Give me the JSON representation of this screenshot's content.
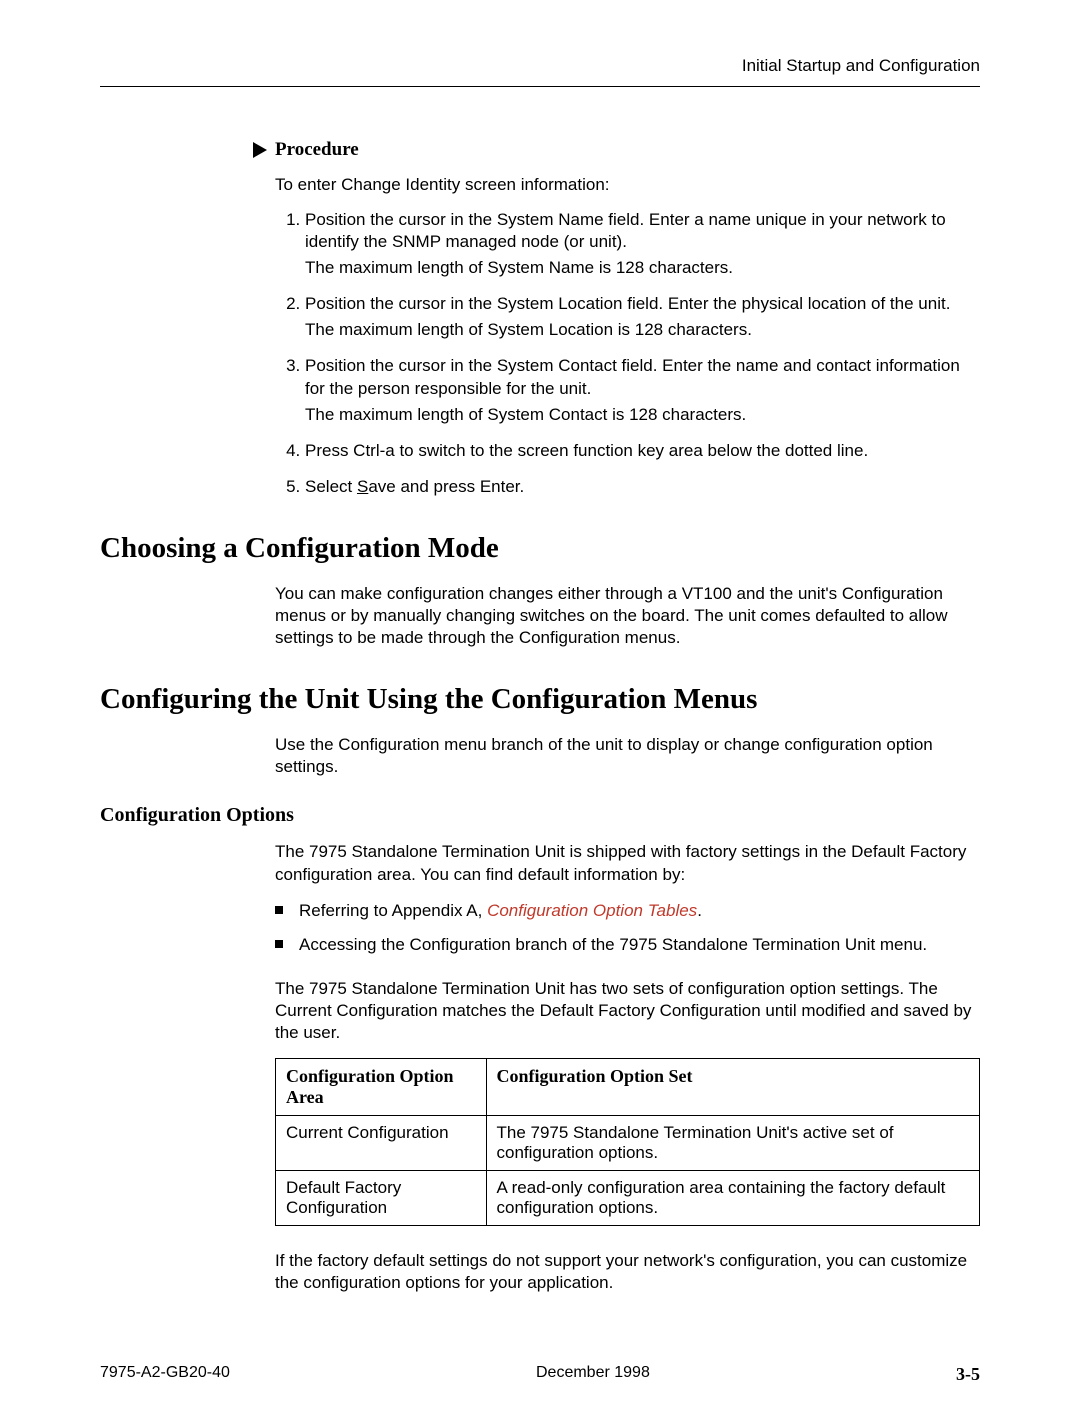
{
  "header": {
    "running_head": "Initial Startup and Configuration"
  },
  "procedure": {
    "label": "Procedure",
    "intro": "To enter Change Identity screen information:",
    "steps": [
      {
        "main": "Position the cursor in the System Name field. Enter a name unique in your network to identify the SNMP managed node (or unit).",
        "sub": "The maximum length of System Name is 128 characters."
      },
      {
        "main": "Position the cursor in the System Location field. Enter the physical location of the unit.",
        "sub": "The maximum length of System Location is 128 characters."
      },
      {
        "main": "Position the cursor in the System Contact field. Enter the name and contact information for the person responsible for the unit.",
        "sub": "The maximum length of System Contact is 128 characters."
      },
      {
        "main": "Press Ctrl-a to switch to the screen function key area below the dotted line.",
        "sub": ""
      },
      {
        "main_pre": "Select ",
        "main_u": "S",
        "main_post": "ave and press Enter.",
        "sub": ""
      }
    ]
  },
  "section1": {
    "title": "Choosing a Configuration Mode",
    "body": "You can make configuration changes either through a VT100 and the unit's Configuration menus or by manually changing switches on the board. The unit comes defaulted to allow settings to be made through the Configuration menus."
  },
  "section2": {
    "title": "Configuring the Unit Using the Configuration Menus",
    "body": "Use the Configuration menu branch of the unit to display or change configuration option settings."
  },
  "subsection": {
    "title": "Configuration Options",
    "p1": "The 7975 Standalone Termination Unit is shipped with factory settings in the Default Factory configuration area. You can find default information by:",
    "bullets": [
      {
        "pre": "Referring to Appendix A, ",
        "link": "Configuration Option Tables",
        "post": "."
      },
      {
        "pre": "Accessing the Configuration branch of the 7975 Standalone Termination Unit menu.",
        "link": "",
        "post": ""
      }
    ],
    "p2": "The 7975 Standalone Termination Unit has two sets of configuration option settings. The Current Configuration matches the Default Factory Configuration until modified and saved by the user.",
    "table": {
      "h1": "Configuration Option Area",
      "h2": "Configuration Option Set",
      "rows": [
        {
          "c1": "Current Configuration",
          "c2": "The 7975 Standalone Termination Unit's active set of configuration options."
        },
        {
          "c1": "Default Factory Configuration",
          "c2": "A read-only configuration area containing the factory default configuration options."
        }
      ]
    },
    "p3": "If the factory default settings do not support your network's configuration, you can customize the configuration options for your application."
  },
  "footer": {
    "left": "7975-A2-GB20-40",
    "center": "December 1998",
    "right": "3-5"
  }
}
